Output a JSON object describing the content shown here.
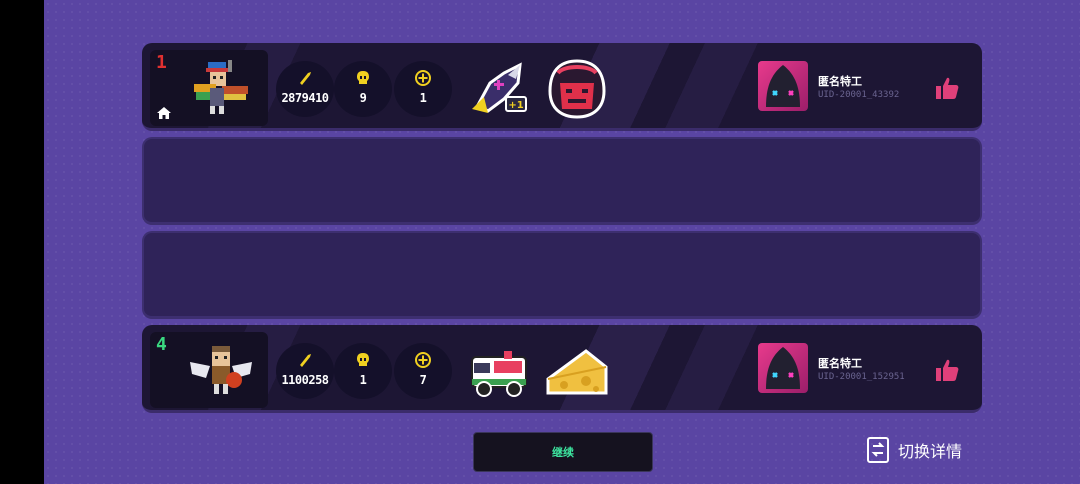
{
  "players": [
    {
      "rank": "1",
      "rank_color": "#e03030",
      "host": true,
      "stats": {
        "ammo": "2879410",
        "kills": "9",
        "revives": "1"
      },
      "items": [
        "ninja-shark-pet",
        "devil-mask-buff"
      ],
      "name": "匿名特工",
      "uid": "UID-20001_43392"
    },
    {
      "rank": "4",
      "rank_color": "#3ad880",
      "host": false,
      "stats": {
        "ammo": "1100258",
        "kills": "1",
        "revives": "7"
      },
      "items": [
        "ambulance-vehicle",
        "cheese-item"
      ],
      "name": "匿名特工",
      "uid": "UID-20001_152951"
    }
  ],
  "item_badge": "+1",
  "buttons": {
    "continue": "继续",
    "switch_details": "切换详情"
  },
  "colors": {
    "background": "#5a45a3",
    "row_bg": "#1d1634",
    "empty_row_bg": "#2f2359",
    "continue_text": "#3de6a0",
    "like": "#e0407a"
  }
}
